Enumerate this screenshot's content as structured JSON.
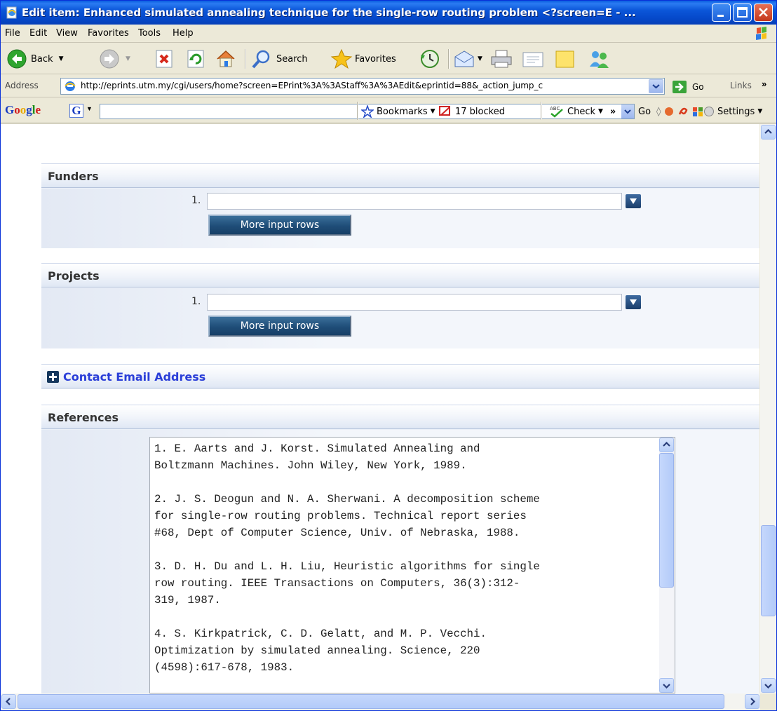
{
  "window": {
    "title": "Edit item: Enhanced simulated annealing technique for the single-row routing problem <?screen=E - ..."
  },
  "menu": [
    "File",
    "Edit",
    "View",
    "Favorites",
    "Tools",
    "Help"
  ],
  "toolbar": {
    "back_label": "Back",
    "search_label": "Search",
    "favorites_label": "Favorites"
  },
  "address": {
    "label": "Address",
    "url": "http://eprints.utm.my/cgi/users/home?screen=EPrint%3A%3AStaff%3A%3AEdit&eprintid=88&_action_jump_c",
    "go_label": "Go",
    "links_label": "Links"
  },
  "google_toolbar": {
    "logo": [
      "G",
      "o",
      "o",
      "g",
      "l",
      "e"
    ],
    "go_label": "Go",
    "bookmarks_label": "Bookmarks",
    "blocked_label": "17 blocked",
    "check_label": "Check",
    "settings_label": "Settings"
  },
  "funders": {
    "title": "Funders",
    "row_number": "1.",
    "value": "",
    "more_rows_label": "More input rows"
  },
  "projects": {
    "title": "Projects",
    "row_number": "1.",
    "value": "",
    "more_rows_label": "More input rows"
  },
  "contact_email": {
    "title": "Contact Email Address"
  },
  "references": {
    "title": "References",
    "text": "1. E. Aarts and J. Korst. Simulated Annealing and\nBoltzmann Machines. John Wiley, New York, 1989.\n\n2. J. S. Deogun and N. A. Sherwani. A decomposition scheme\nfor single-row routing problems. Technical report series\n#68, Dept of Computer Science, Univ. of Nebraska, 1988.\n\n3. D. H. Du and L. H. Liu, Heuristic algorithms for single\nrow routing. IEEE Transactions on Computers, 36(3):312-\n319, 1987.\n\n4. S. Kirkpatrick, C. D. Gelatt, and M. P. Vecchi.\nOptimization by simulated annealing. Science, 220\n(4598):617-678, 1983."
  },
  "colors": {
    "titlebar": "#0b56d9",
    "section_header": "#dfe7f4",
    "section_body": "#f3f6fb",
    "button": "#1f4d78",
    "link": "#2a3ed8"
  }
}
